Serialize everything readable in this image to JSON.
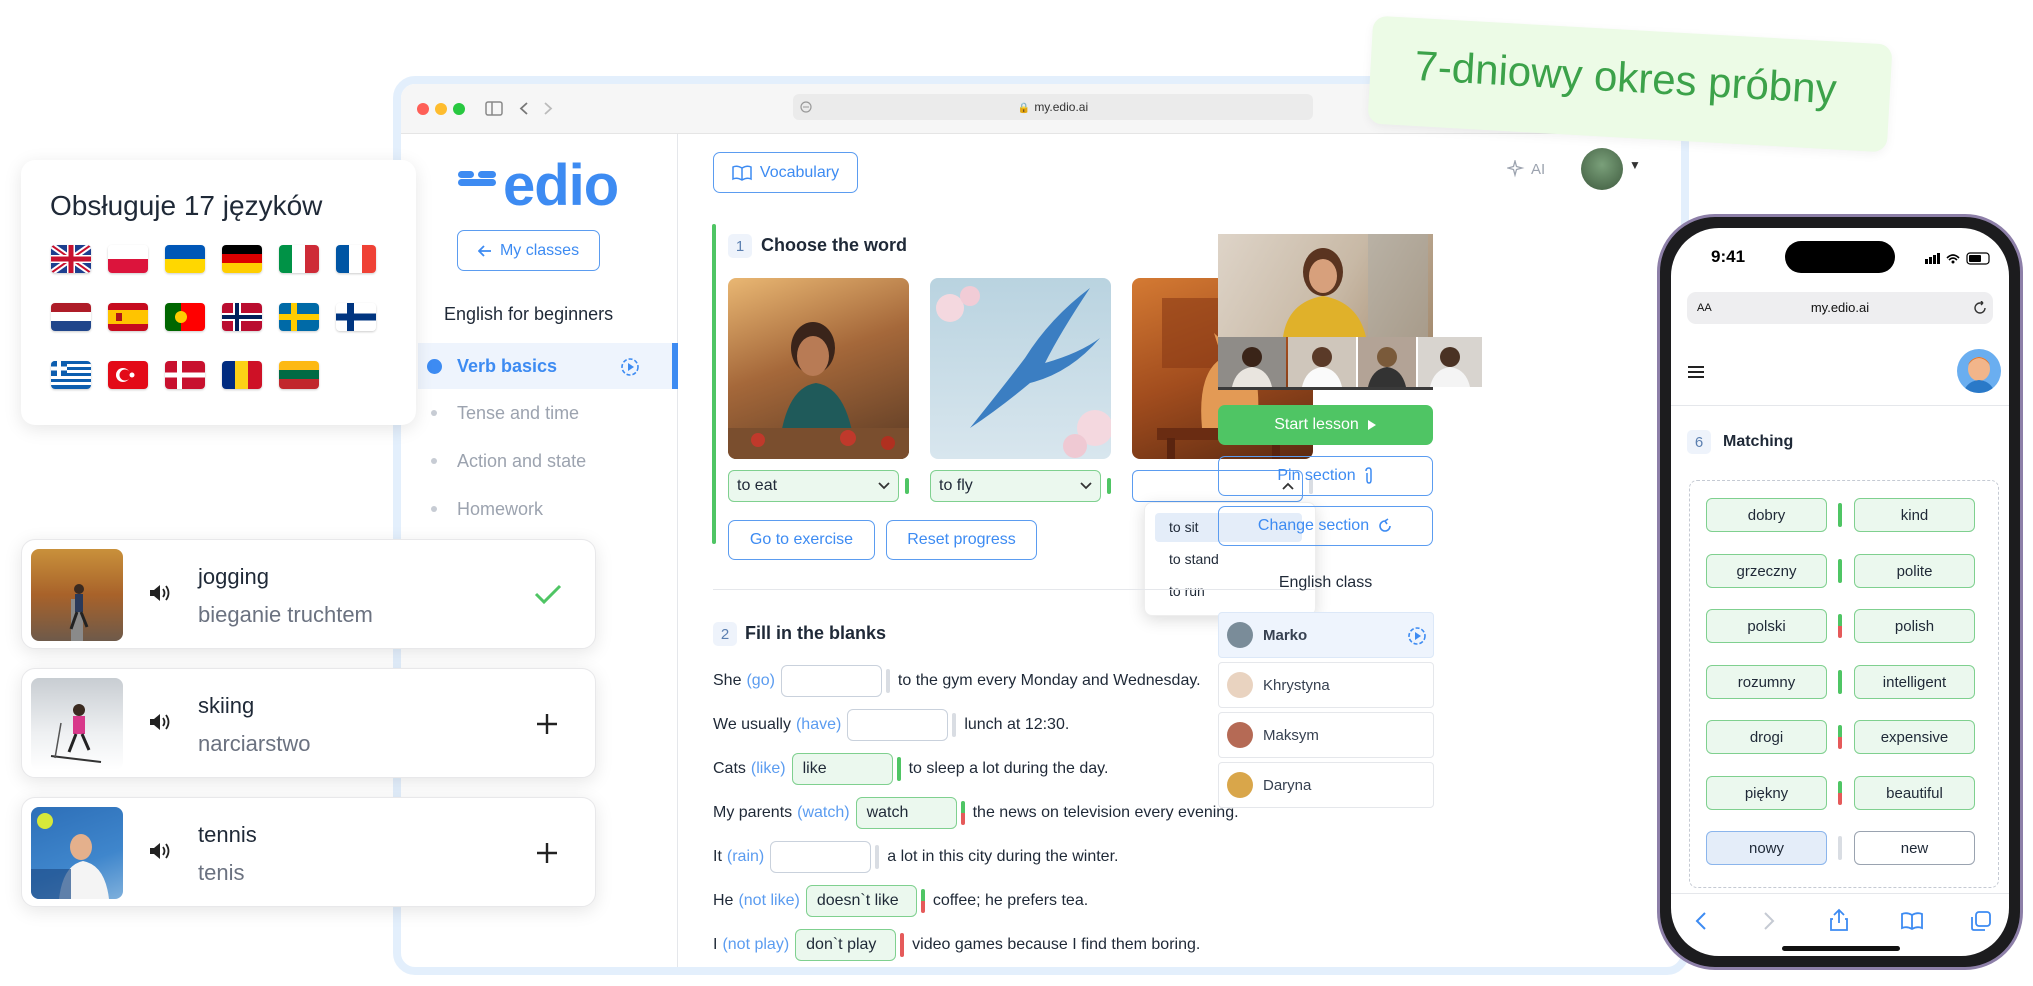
{
  "trial_badge": "7-dniowy okres próbny",
  "browser": {
    "url": "my.edio.ai"
  },
  "brand": {
    "name": "edio",
    "color": "#3d8bf2"
  },
  "sidebar": {
    "my_classes": "My classes",
    "course_title": "English for beginners",
    "items": [
      {
        "label": "Verb basics",
        "active": true
      },
      {
        "label": "Tense and time"
      },
      {
        "label": "Action and state"
      },
      {
        "label": "Homework"
      }
    ]
  },
  "toolbar": {
    "vocabulary": "Vocabulary",
    "ai": "AI"
  },
  "section1": {
    "number": "1",
    "title": "Choose the word",
    "selects": [
      "to eat",
      "to fly",
      ""
    ],
    "dropdown_options": [
      "to sit",
      "to stand",
      "to run"
    ],
    "go_to_exercise": "Go to exercise",
    "reset_progress": "Reset progress"
  },
  "section2": {
    "number": "2",
    "title": "Fill in the blanks",
    "sentences": [
      {
        "pre": "She",
        "hint": "(go)",
        "answer": "",
        "post": "to the gym every Monday and Wednesday."
      },
      {
        "pre": "We usually",
        "hint": "(have)",
        "answer": "",
        "post": "lunch at 12:30."
      },
      {
        "pre": "Cats",
        "hint": "(like)",
        "answer": "like",
        "post": "to sleep a lot during the day."
      },
      {
        "pre": "My parents",
        "hint": "(watch)",
        "answer": "watch",
        "post": "the news on television every evening."
      },
      {
        "pre": "It",
        "hint": "(rain)",
        "answer": "",
        "post": "a lot in this city during the winter."
      },
      {
        "pre": "He",
        "hint": "(not like)",
        "answer": "doesn`t like",
        "post": "coffee; he prefers tea."
      },
      {
        "pre": "I",
        "hint": "(not play)",
        "answer": "don`t play",
        "post": "video games because I find them boring."
      }
    ]
  },
  "right_panel": {
    "start_lesson": "Start lesson",
    "pin_section": "Pin section",
    "change_section": "Change section",
    "class_title": "English class",
    "students": [
      "Marko",
      "Khrystyna",
      "Maksym",
      "Daryna"
    ]
  },
  "languages_card": {
    "title": "Obsługuje 17 języków",
    "flags": [
      "gb",
      "pl",
      "ua",
      "de",
      "it",
      "fr",
      "nl",
      "es",
      "pt",
      "no",
      "se",
      "fi",
      "gr",
      "tr",
      "dk",
      "ro",
      "lt"
    ]
  },
  "vocab_cards": [
    {
      "word": "jogging",
      "translation": "bieganie truchtem",
      "state": "added"
    },
    {
      "word": "skiing",
      "translation": "narciarstwo",
      "state": "add"
    },
    {
      "word": "tennis",
      "translation": "tenis",
      "state": "add"
    }
  ],
  "phone": {
    "time": "9:41",
    "url": "my.edio.ai",
    "aa": "AA",
    "section_number": "6",
    "section_title": "Matching",
    "pairs": [
      {
        "left": "dobry",
        "right": "kind",
        "status": "ok"
      },
      {
        "left": "grzeczny",
        "right": "polite",
        "status": "ok"
      },
      {
        "left": "polski",
        "right": "polish",
        "status": "bad"
      },
      {
        "left": "rozumny",
        "right": "intelligent",
        "status": "ok"
      },
      {
        "left": "drogi",
        "right": "expensive",
        "status": "bad"
      },
      {
        "left": "piękny",
        "right": "beautiful",
        "status": "bad"
      },
      {
        "left": "nowy",
        "right": "new",
        "status": "pending"
      }
    ]
  },
  "colors": {
    "accent": "#3d8bf2",
    "success": "#4fc564",
    "error": "#e55a5a"
  }
}
